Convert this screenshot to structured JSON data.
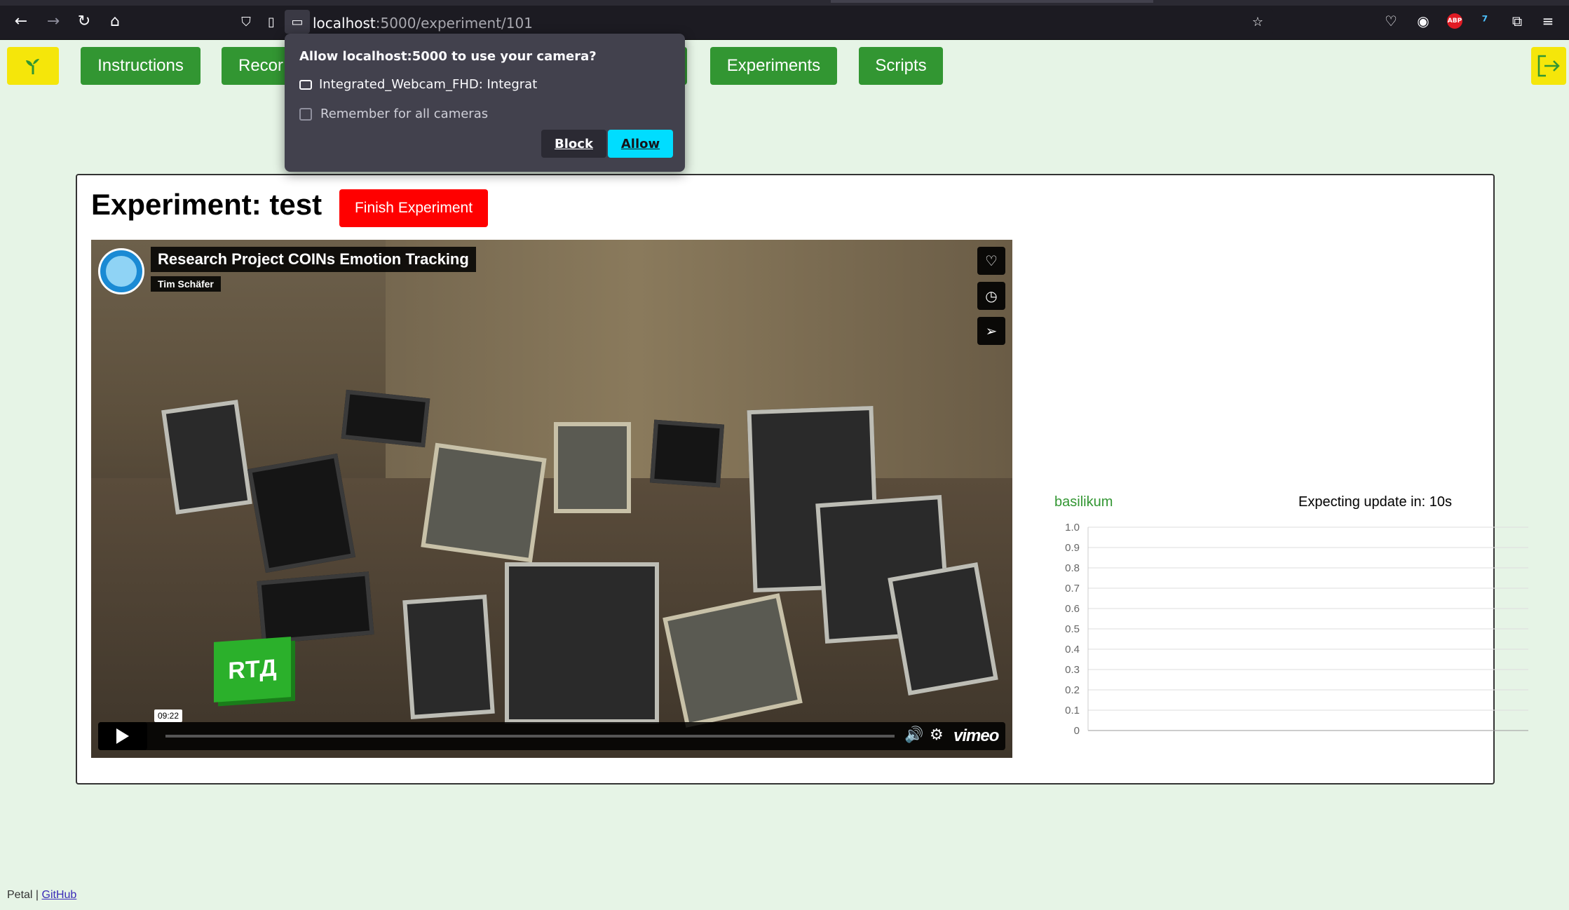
{
  "browser": {
    "url_host": "localhost",
    "url_rest": ":5000/experiment/101"
  },
  "nav": {
    "items": [
      "Instructions",
      "Recor",
      "Experiments",
      "Scripts"
    ]
  },
  "permission": {
    "title": "Allow localhost:5000 to use your camera?",
    "camera": "Integrated_Webcam_FHD: Integrat",
    "remember": "Remember for all cameras",
    "block": "Block",
    "allow": "Allow"
  },
  "experiment": {
    "title": "Experiment: test",
    "finish_button": "Finish Experiment"
  },
  "video": {
    "title": "Research Project COINs Emotion Tracking",
    "author": "Tim Schäfer",
    "time": "09:22",
    "brand": "vimeo",
    "rt_logo": "RTД"
  },
  "chart": {
    "label": "basilikum",
    "update": "Expecting update in: 10s"
  },
  "chart_data": {
    "type": "line",
    "title": "",
    "series": [],
    "x": [],
    "ylim": [
      0,
      1.0
    ],
    "yticks": [
      "1.0",
      "0.9",
      "0.8",
      "0.7",
      "0.6",
      "0.5",
      "0.4",
      "0.3",
      "0.2",
      "0.1",
      "0"
    ],
    "grid": true
  },
  "footer": {
    "app": "Petal",
    "sep": "|",
    "link": "GitHub"
  },
  "colors": {
    "green": "#329632",
    "yellow": "#f5e60a",
    "red": "#ff0000",
    "allow": "#00ddff"
  }
}
